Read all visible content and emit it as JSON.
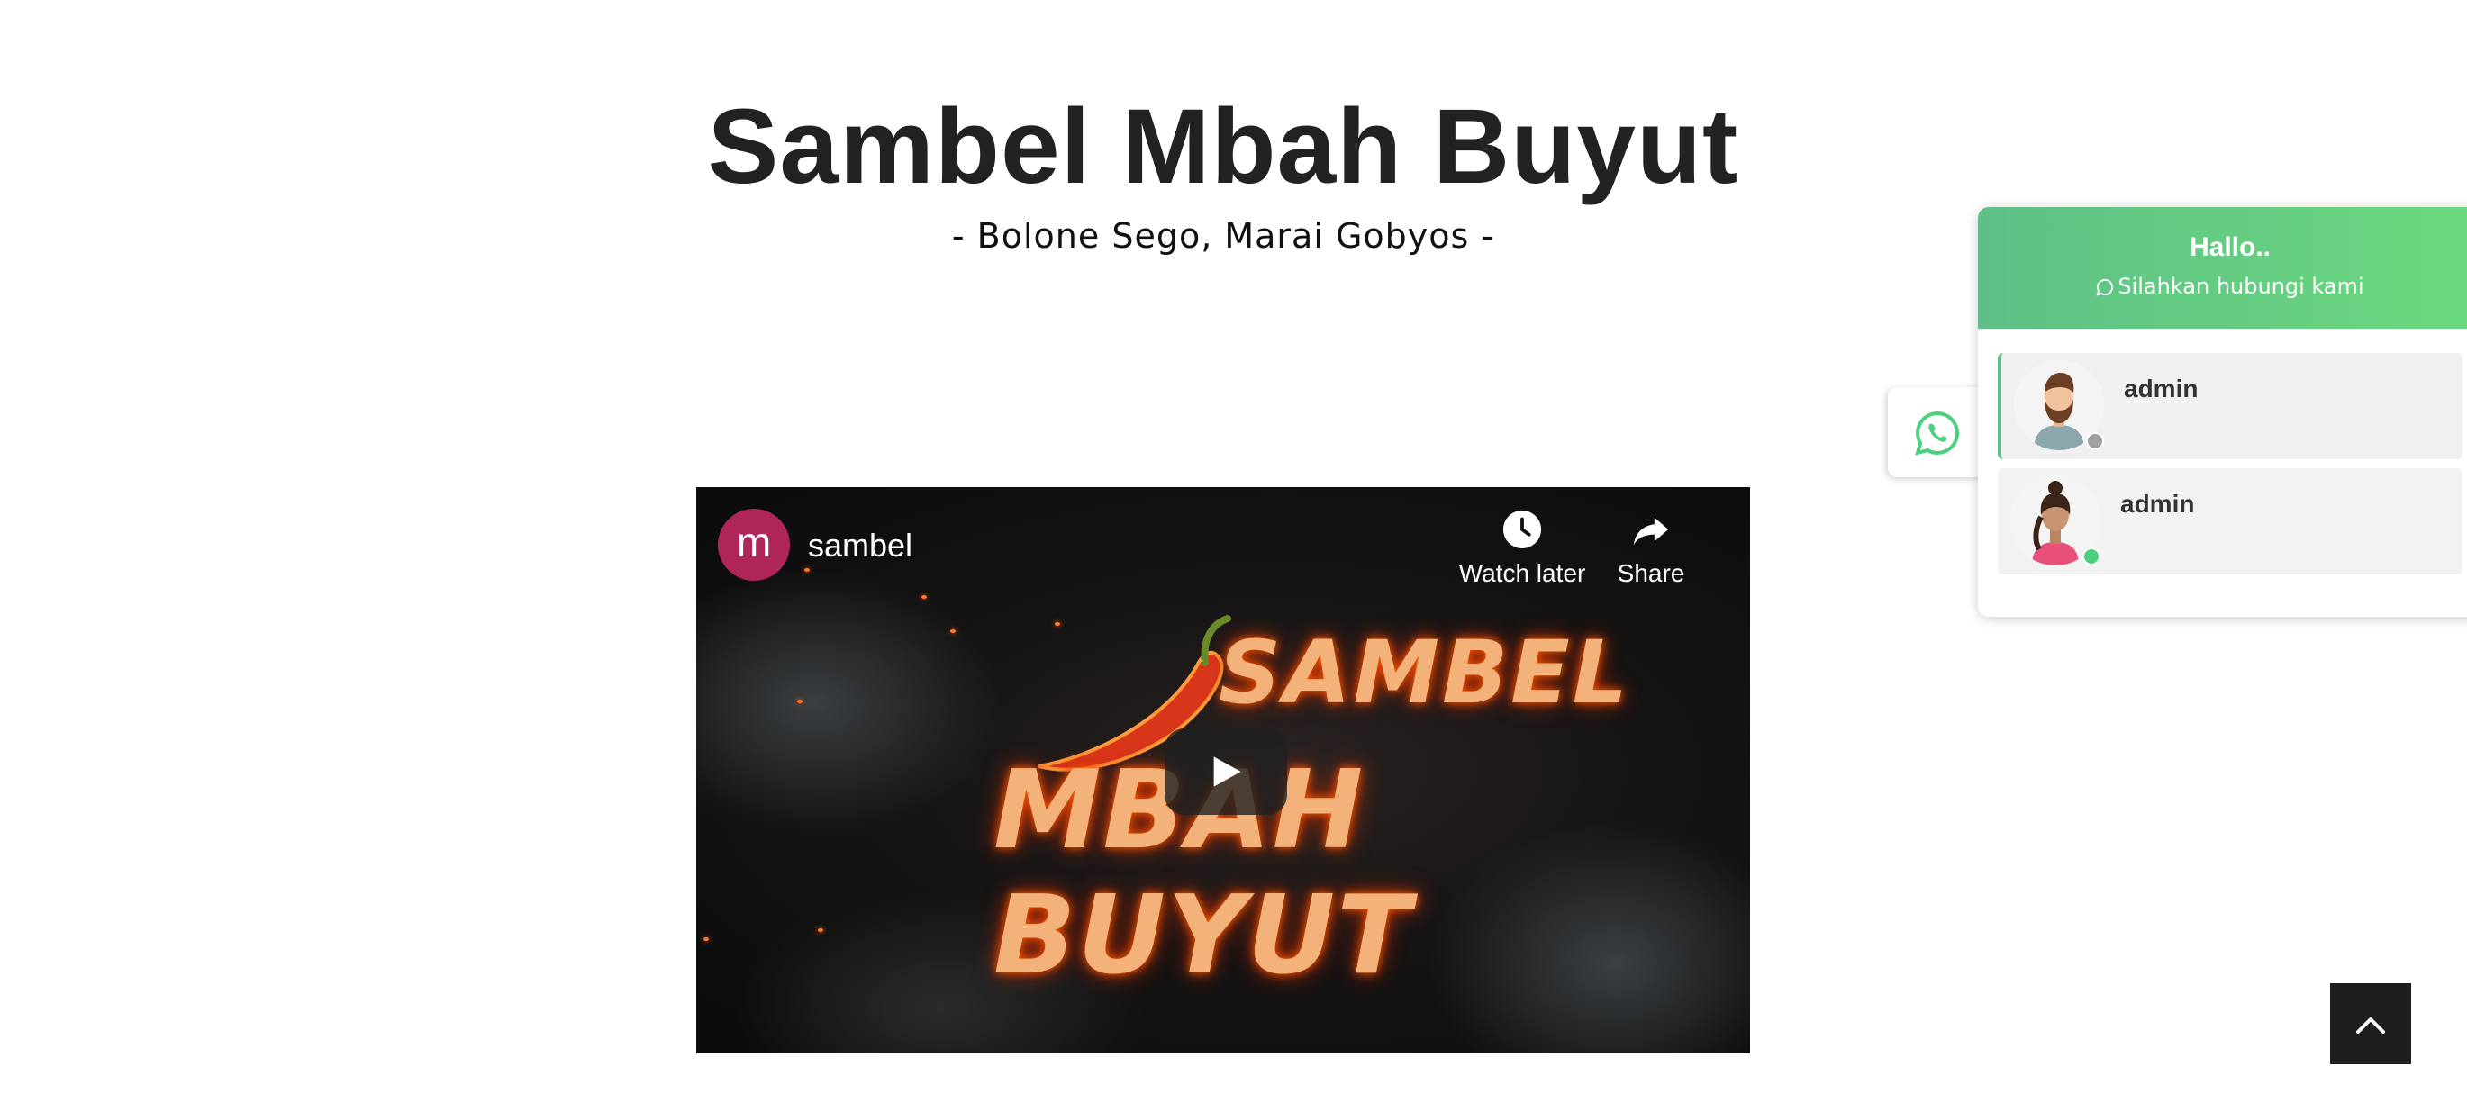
{
  "site": {
    "title": "Sambel Mbah Buyut",
    "tagline": "- Bolone Sego, Marai Gobyos -"
  },
  "video": {
    "channel_initial": "m",
    "channel_name": "sambel",
    "watch_later_label": "Watch later",
    "share_label": "Share",
    "logo_line1": "SAMBEL",
    "logo_line2": "MBAH BUYUT",
    "icons": [
      "clock-icon",
      "share-arrow-icon",
      "play-icon",
      "chili-icon"
    ]
  },
  "whatsapp": {
    "greeting": "Hallo..",
    "subtitle": "Silahkan hubungi kami",
    "accent_color": "#5ec086",
    "agents": [
      {
        "name": "admin",
        "status": "offline",
        "status_color": "#a0a0a0",
        "avatar": "male-avatar"
      },
      {
        "name": "admin",
        "status": "online",
        "status_color": "#4cd07d",
        "avatar": "female-avatar"
      }
    ]
  },
  "back_to_top": {
    "icon": "chevron-up-icon"
  }
}
